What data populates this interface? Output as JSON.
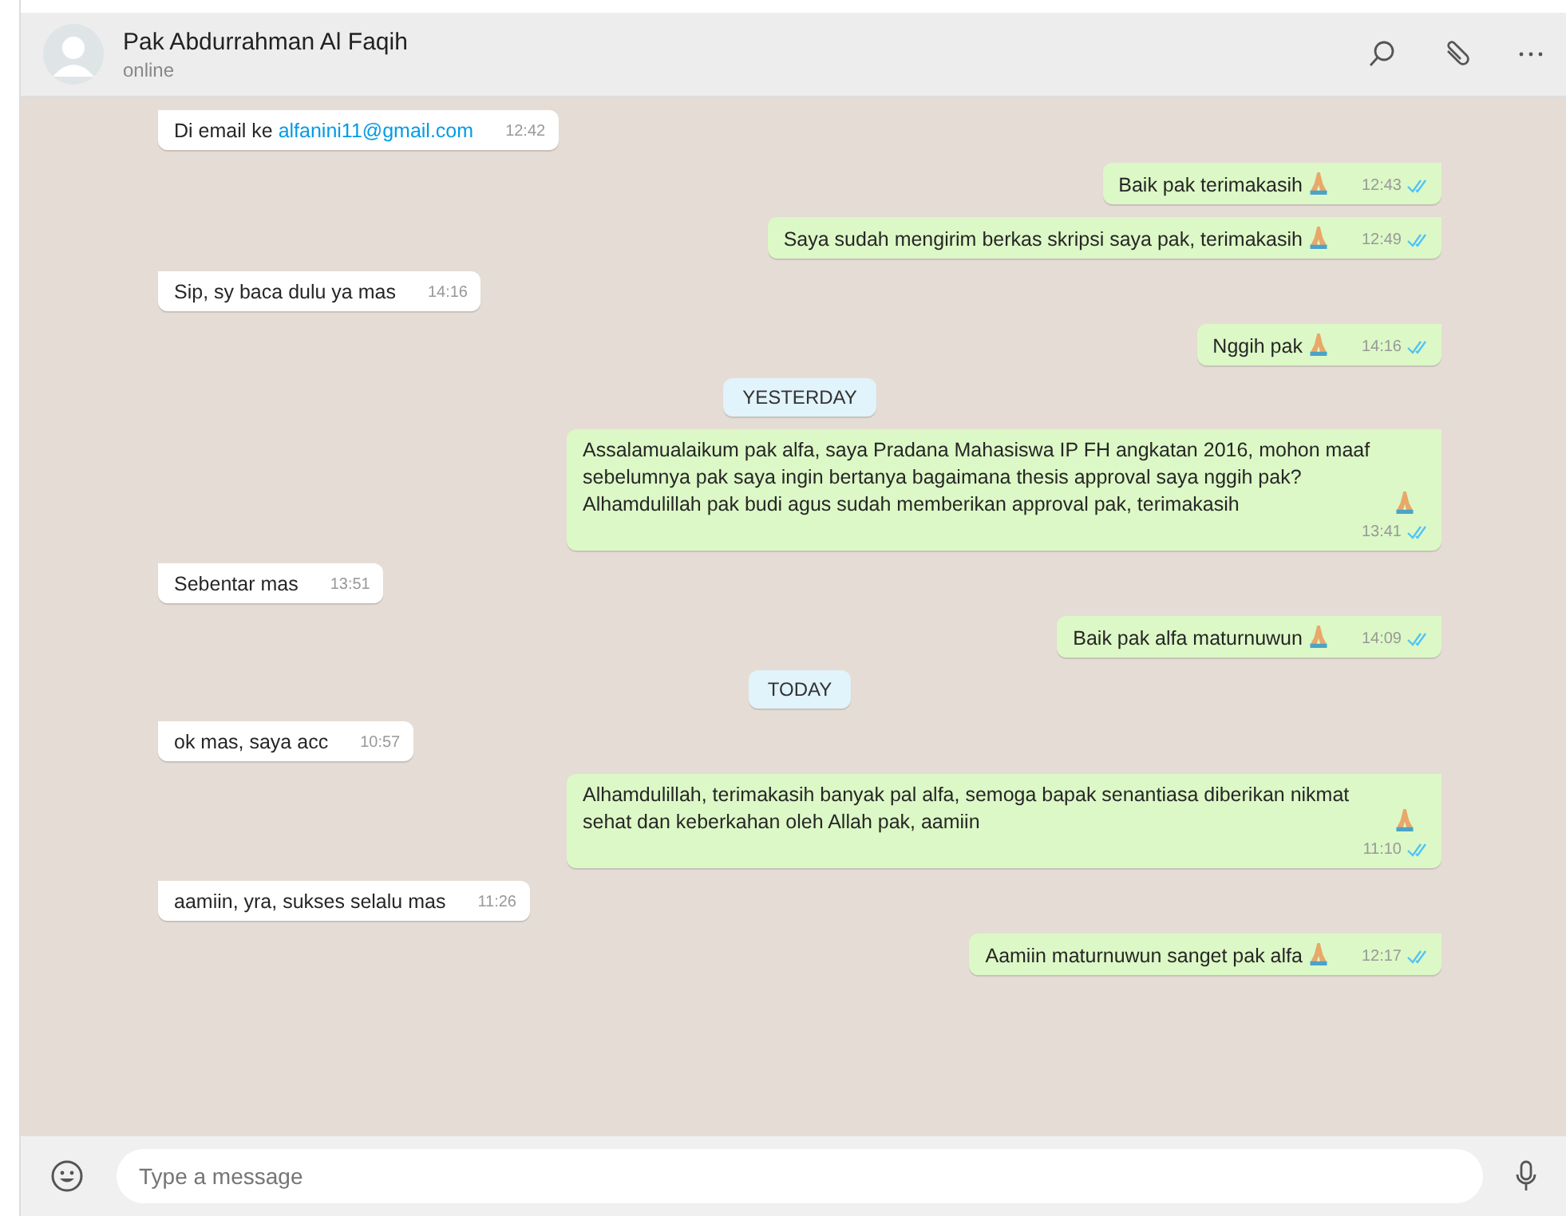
{
  "header": {
    "name": "Pak Abdurrahman Al Faqih",
    "status": "online"
  },
  "messages": [
    {
      "kind": "in",
      "text": "Di email ke",
      "link": "alfanini11@gmail.com",
      "time": "12:42"
    },
    {
      "kind": "out",
      "text": "Baik pak terimakasih",
      "hands": true,
      "time": "12:43",
      "read": true
    },
    {
      "kind": "out",
      "text": "Saya sudah mengirim berkas skripsi saya pak, terimakasih",
      "hands": true,
      "time": "12:49",
      "read": true
    },
    {
      "kind": "in",
      "text": "Sip, sy baca dulu ya mas",
      "time": "14:16"
    },
    {
      "kind": "out",
      "text": "Nggih pak",
      "hands": true,
      "time": "14:16",
      "read": true
    },
    {
      "kind": "date",
      "text": "YESTERDAY"
    },
    {
      "kind": "out",
      "text": "Assalamualaikum pak alfa, saya Pradana Mahasiswa IP FH angkatan 2016, mohon maaf sebelumnya pak saya ingin bertanya bagaimana thesis approval saya nggih pak? Alhamdulillah pak budi agus sudah memberikan approval pak, terimakasih",
      "hands": true,
      "time": "13:41",
      "read": true
    },
    {
      "kind": "in",
      "text": "Sebentar mas",
      "time": "13:51"
    },
    {
      "kind": "out",
      "text": "Baik pak alfa maturnuwun",
      "hands": true,
      "time": "14:09",
      "read": true
    },
    {
      "kind": "date",
      "text": "TODAY"
    },
    {
      "kind": "in",
      "text": "ok mas, saya acc",
      "time": "10:57"
    },
    {
      "kind": "out",
      "text": "Alhamdulillah, terimakasih banyak pal alfa, semoga bapak senantiasa diberikan nikmat sehat dan keberkahan oleh Allah pak, aamiin",
      "hands": true,
      "time": "11:10",
      "read": true
    },
    {
      "kind": "in",
      "text": "aamiin, yra, sukses selalu mas",
      "time": "11:26"
    },
    {
      "kind": "out",
      "text": "Aamiin maturnuwun sanget pak alfa",
      "hands": true,
      "time": "12:17",
      "read": true
    }
  ],
  "composer": {
    "placeholder": "Type a message"
  }
}
